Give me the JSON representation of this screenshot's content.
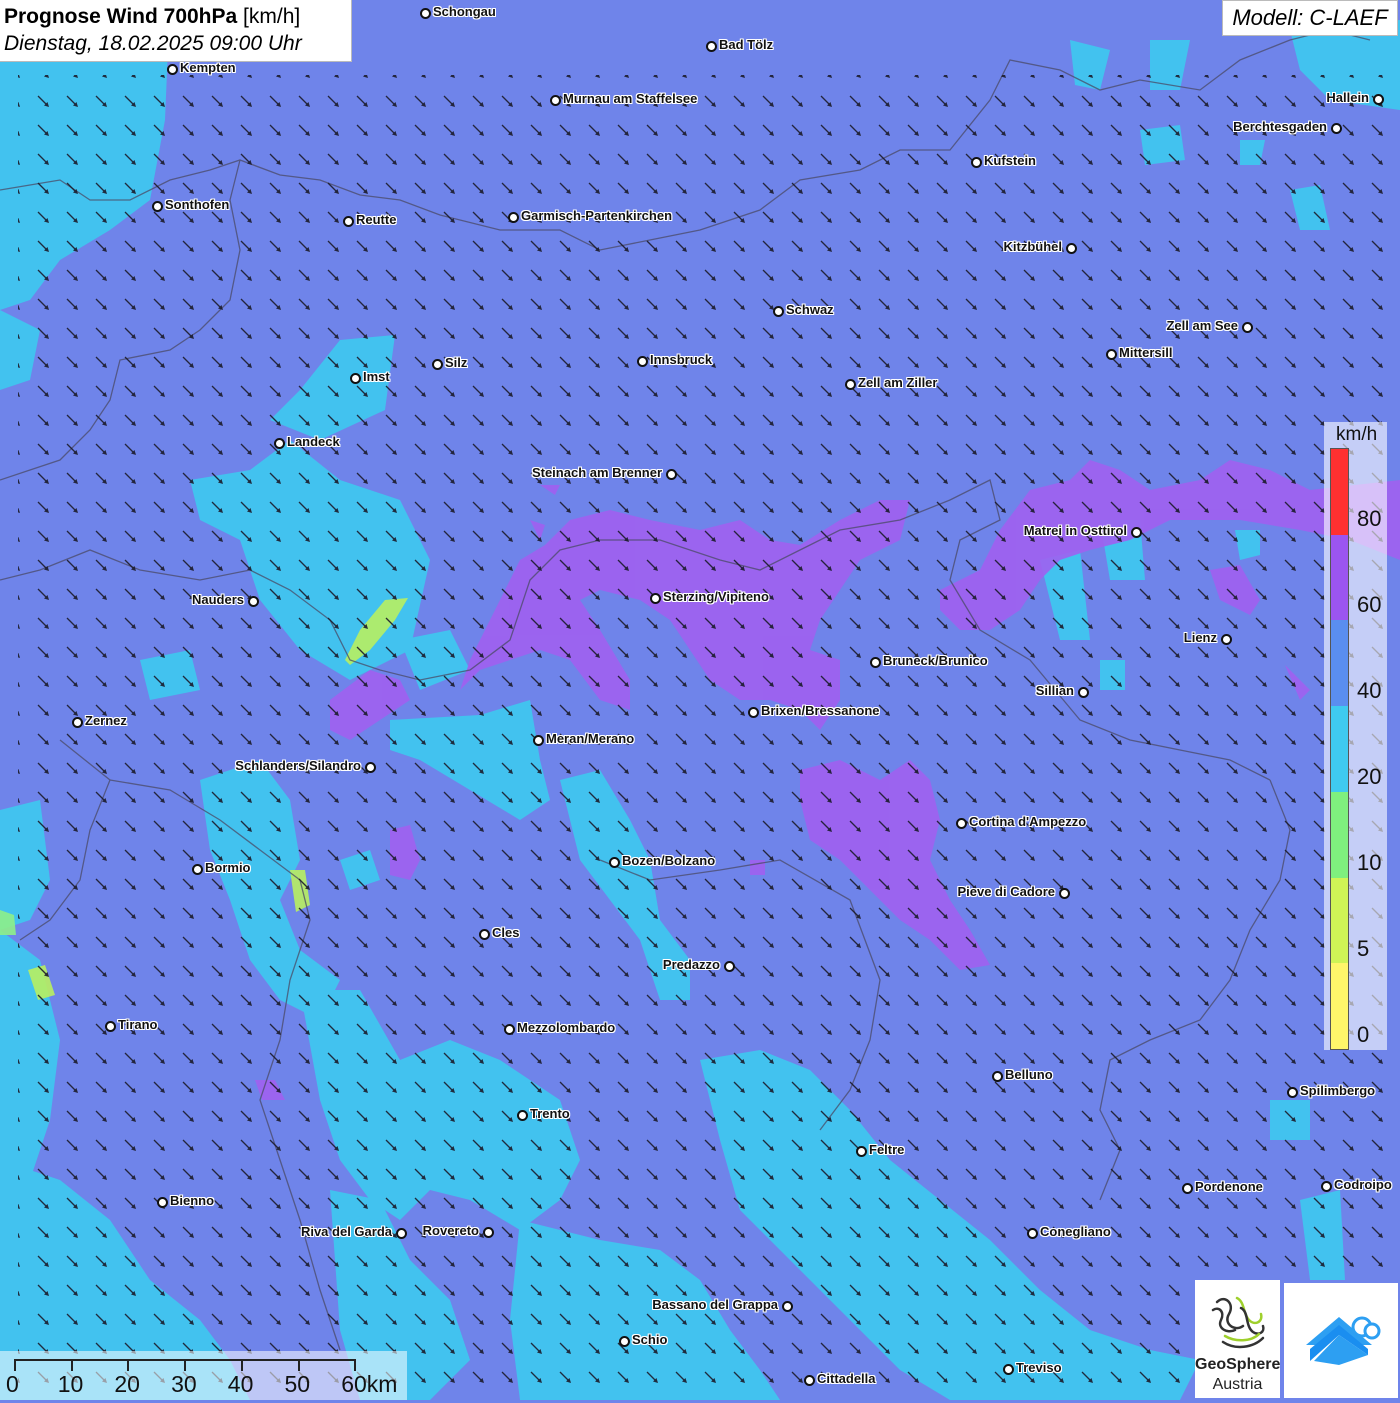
{
  "header": {
    "title_bold": "Prognose Wind 700hPa",
    "title_unit": "[km/h]",
    "datetime": "Dienstag, 18.02.2025 09:00 Uhr"
  },
  "model": "Modell: C-LAEF",
  "colors": {
    "base_wind": "#6f84ea",
    "band_20_40": "#3bd0f0",
    "band_60_80": "#a060f0",
    "band_10_20": "#8ef088",
    "band_5_10": "#caf060"
  },
  "legend": {
    "unit": "km/h",
    "labels": [
      "80",
      "60",
      "40",
      "20",
      "10",
      "5",
      "0"
    ],
    "segments": [
      {
        "from": 80,
        "color": "#ff3030"
      },
      {
        "from": 60,
        "color": "#9b55f0"
      },
      {
        "from": 40,
        "color": "#5a8ef0"
      },
      {
        "from": 20,
        "color": "#3fcaf0"
      },
      {
        "from": 10,
        "color": "#7ff07e"
      },
      {
        "from": 5,
        "color": "#cff456"
      },
      {
        "from": 0,
        "color": "#fff66a"
      }
    ]
  },
  "scale_bar": {
    "labels": [
      "0",
      "10",
      "20",
      "30",
      "40",
      "50",
      "60km"
    ]
  },
  "logos": {
    "geosphere_line1": "GeoSphere",
    "geosphere_line2": "Austria"
  },
  "cities": [
    {
      "name": "Schongau"
    },
    {
      "name": "Bad Tölz"
    },
    {
      "name": "Kempten"
    },
    {
      "name": "Murnau am Staffelsee"
    },
    {
      "name": "Hallein"
    },
    {
      "name": "Berchtesgaden"
    },
    {
      "name": "Kufstein"
    },
    {
      "name": "Sonthofen"
    },
    {
      "name": "Reutte"
    },
    {
      "name": "Garmisch-Partenkirchen"
    },
    {
      "name": "Kitzbühel"
    },
    {
      "name": "Schwaz"
    },
    {
      "name": "Zell am See"
    },
    {
      "name": "Mittersill"
    },
    {
      "name": "Innsbruck"
    },
    {
      "name": "Silz"
    },
    {
      "name": "Imst"
    },
    {
      "name": "Zell am Ziller"
    },
    {
      "name": "Landeck"
    },
    {
      "name": "Steinach am Brenner"
    },
    {
      "name": "Matrei in Osttirol"
    },
    {
      "name": "Nauders"
    },
    {
      "name": "Sterzing/Vipiteno"
    },
    {
      "name": "Lienz"
    },
    {
      "name": "Bruneck/Brunico"
    },
    {
      "name": "Sillian"
    },
    {
      "name": "Brixen/Bressanone"
    },
    {
      "name": "Zernez"
    },
    {
      "name": "Meran/Merano"
    },
    {
      "name": "Schlanders/Silandro"
    },
    {
      "name": "Cortina d'Ampezzo"
    },
    {
      "name": "Bozen/Bolzano"
    },
    {
      "name": "Bormio"
    },
    {
      "name": "Pieve di Cadore"
    },
    {
      "name": "Cles"
    },
    {
      "name": "Predazzo"
    },
    {
      "name": "Tirano"
    },
    {
      "name": "Mezzolombardo"
    },
    {
      "name": "Belluno"
    },
    {
      "name": "Spilimbergo"
    },
    {
      "name": "Trento"
    },
    {
      "name": "Feltre"
    },
    {
      "name": "Pordenone"
    },
    {
      "name": "Codroipo"
    },
    {
      "name": "Bienno"
    },
    {
      "name": "Riva del Garda"
    },
    {
      "name": "Rovereto"
    },
    {
      "name": "Conegliano"
    },
    {
      "name": "Bassano del Grappa"
    },
    {
      "name": "Schio"
    },
    {
      "name": "Treviso"
    },
    {
      "name": "Cittadella"
    }
  ]
}
